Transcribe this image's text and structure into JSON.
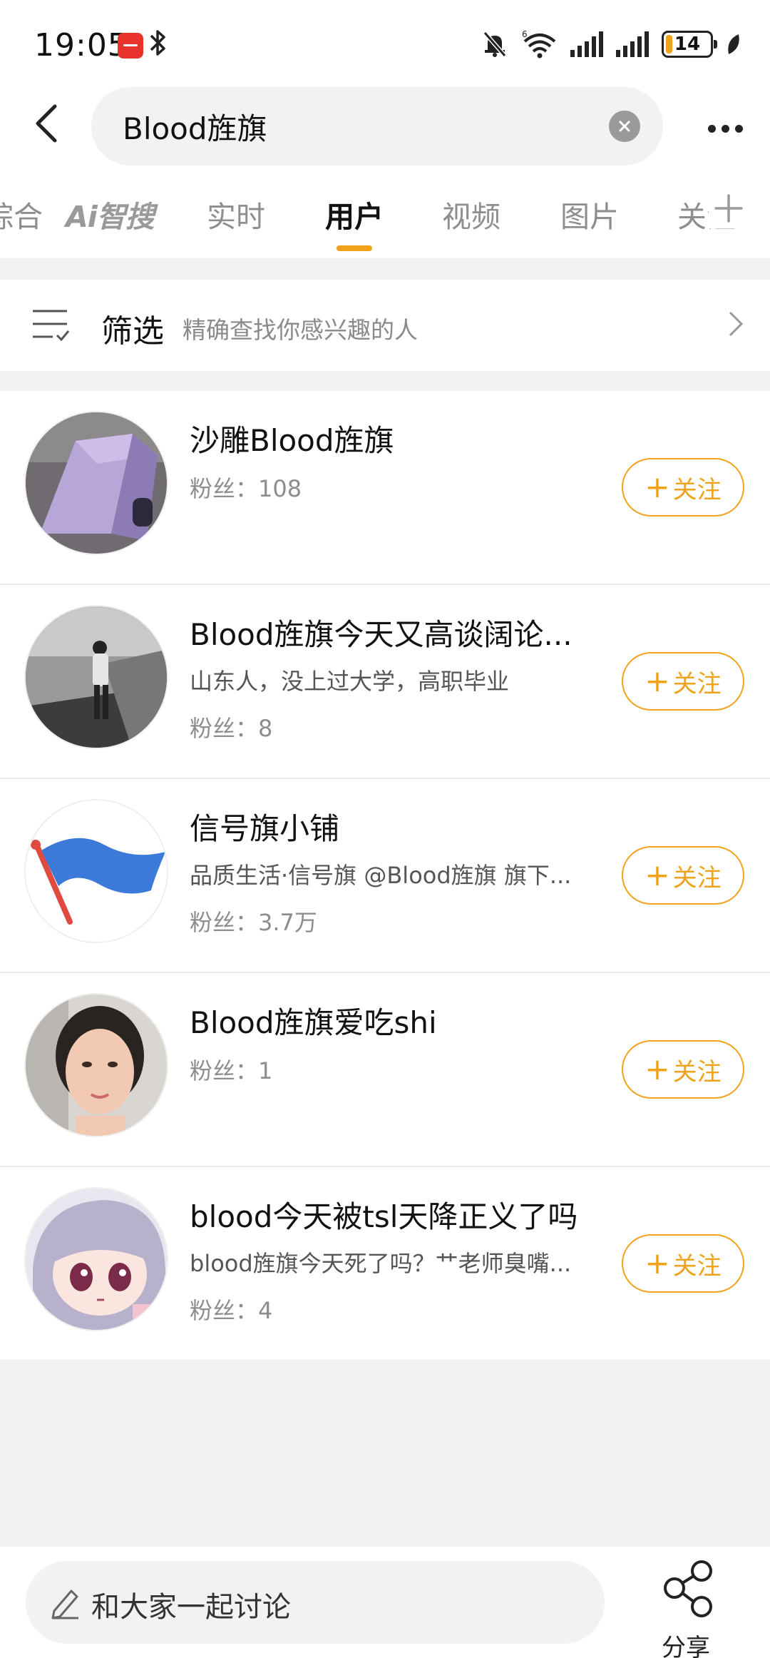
{
  "status_bar": {
    "time": "19:05",
    "battery": "14",
    "battery_level": 0.14,
    "icons": [
      "app-icon",
      "bluetooth-icon",
      "mute-bell-icon",
      "wifi-icon",
      "signal-icon",
      "signal-icon",
      "battery-icon",
      "leaf-icon"
    ]
  },
  "search": {
    "query": "Blood旌旗"
  },
  "tabs": [
    "综合",
    "Ai智搜",
    "实时",
    "用户",
    "视频",
    "图片",
    "关注"
  ],
  "active_tab": "用户",
  "filter": {
    "title": "筛选",
    "subtitle": "精确查找你感兴趣的人"
  },
  "users": [
    {
      "name": "沙雕Blood旌旗",
      "desc": "",
      "fans": "粉丝：108",
      "follow_label": "关注"
    },
    {
      "name": "Blood旌旗今天又高谈阔论...",
      "desc": "山东人，没上过大学，高职毕业",
      "fans": "粉丝：8",
      "follow_label": "关注"
    },
    {
      "name": "信号旗小铺",
      "desc": "品质生活·信号旗 @Blood旌旗 旗下...",
      "fans": "粉丝：3.7万",
      "follow_label": "关注"
    },
    {
      "name": "Blood旌旗爱吃shi",
      "desc": "",
      "fans": "粉丝：1",
      "follow_label": "关注"
    },
    {
      "name": "blood今天被tsl天降正义了吗",
      "desc": "blood旌旗今天死了吗？艹老师臭嘴...",
      "fans": "粉丝：4",
      "follow_label": "关注"
    }
  ],
  "bottom_bar": {
    "discuss_placeholder": "和大家一起讨论",
    "share_label": "分享"
  },
  "colors": {
    "accent": "#f0a21a",
    "background": "#f2f2f2"
  }
}
